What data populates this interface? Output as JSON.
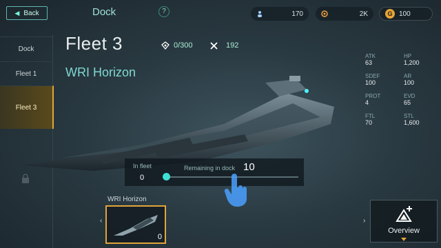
{
  "topbar": {
    "back_label": "Back",
    "title": "Dock",
    "help_label": "?",
    "resources": [
      {
        "icon": "crew-icon",
        "value": "170"
      },
      {
        "icon": "fuel-icon",
        "value": "2K"
      },
      {
        "icon": "g-coin-icon",
        "glyph": "G",
        "value": "100"
      }
    ]
  },
  "sidebar": {
    "items": [
      {
        "label": "Dock"
      },
      {
        "label": "Fleet 1"
      },
      {
        "label": "Fleet 3"
      }
    ],
    "active_index": 2,
    "lock_icon": "lock-icon"
  },
  "fleet": {
    "title": "Fleet 3",
    "ship_name": "WRI Horizon",
    "supply": "0/300",
    "kills": "192"
  },
  "stats": [
    {
      "label": "ATK",
      "value": "63"
    },
    {
      "label": "HP",
      "value": "1,200"
    },
    {
      "label": "SDEF",
      "value": "100"
    },
    {
      "label": "AR",
      "value": "100"
    },
    {
      "label": "PROT",
      "value": "4"
    },
    {
      "label": "EVD",
      "value": "65"
    },
    {
      "label": "FTL",
      "value": "70"
    },
    {
      "label": "STL",
      "value": "1,600"
    }
  ],
  "slider": {
    "in_fleet_label": "In fleet",
    "in_fleet_value": "0",
    "remaining_label": "Remaining in dock",
    "remaining_value": "10",
    "position": 0
  },
  "card": {
    "name": "WRI Horizon",
    "count": "0",
    "left_arrow": "‹",
    "right_arrow": "›"
  },
  "overview": {
    "label": "Overview"
  },
  "colors": {
    "accent": "#e2a53a",
    "teal": "#3ee0d4",
    "ship_name": "#7fd8d2"
  }
}
